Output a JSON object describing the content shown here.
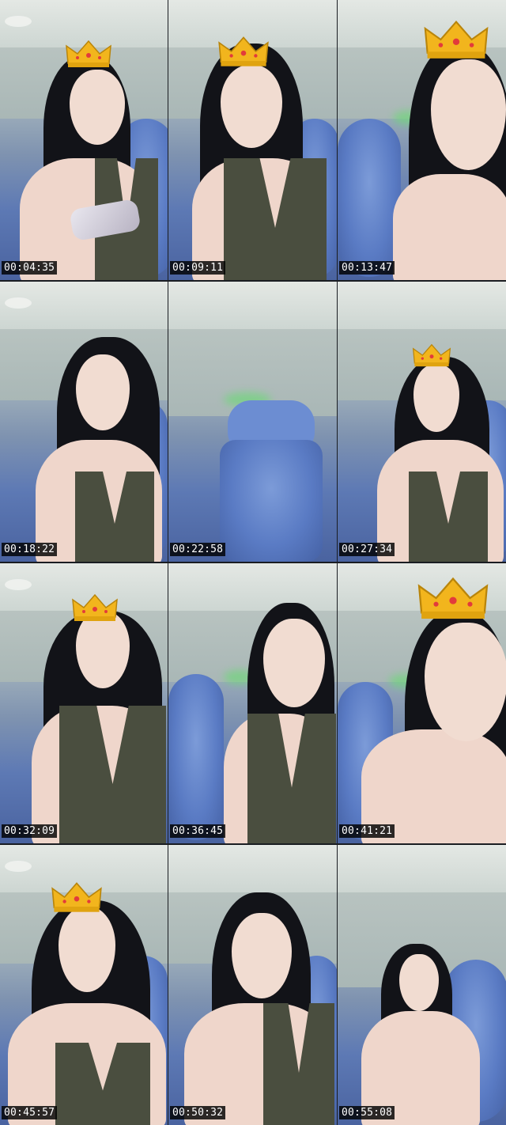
{
  "contact_sheet": {
    "frames": [
      {
        "timestamp": "00:04:35",
        "crown": true
      },
      {
        "timestamp": "00:09:11",
        "crown": true
      },
      {
        "timestamp": "00:13:47",
        "crown": true
      },
      {
        "timestamp": "00:18:22",
        "crown": false
      },
      {
        "timestamp": "00:22:58",
        "crown": false
      },
      {
        "timestamp": "00:27:34",
        "crown": true
      },
      {
        "timestamp": "00:32:09",
        "crown": true
      },
      {
        "timestamp": "00:36:45",
        "crown": false
      },
      {
        "timestamp": "00:41:21",
        "crown": true
      },
      {
        "timestamp": "00:45:57",
        "crown": true
      },
      {
        "timestamp": "00:50:32",
        "crown": false
      },
      {
        "timestamp": "00:55:08",
        "crown": false
      }
    ]
  },
  "colors": {
    "timestamp_background": "#000000",
    "timestamp_text": "#ffffff",
    "chair_blue": "#5a7bc4",
    "dress_olive": "#4a4e3f",
    "crown_gold": "#f2b51d"
  }
}
